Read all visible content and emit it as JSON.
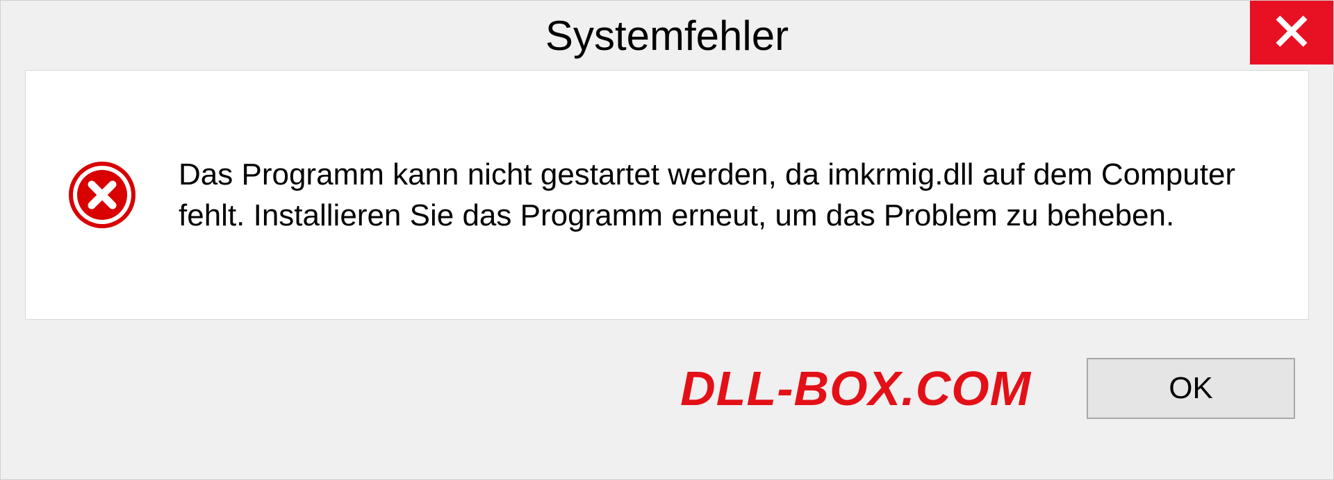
{
  "dialog": {
    "title": "Systemfehler",
    "message": "Das Programm kann nicht gestartet werden, da imkrmig.dll auf dem Computer fehlt. Installieren Sie das Programm erneut, um das Problem zu beheben.",
    "ok_label": "OK"
  },
  "watermark": "DLL-BOX.COM",
  "icons": {
    "close": "close-icon",
    "error": "error-circle-x-icon"
  },
  "colors": {
    "close_bg": "#e81123",
    "error_icon": "#d80000",
    "watermark": "#e31017",
    "dialog_bg": "#f0f0f0",
    "content_bg": "#ffffff"
  }
}
